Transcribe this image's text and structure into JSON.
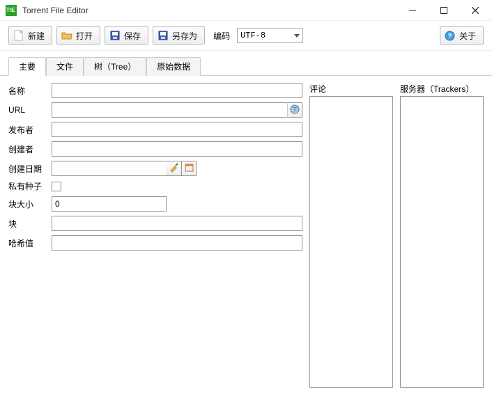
{
  "window": {
    "title": "Torrent File Editor"
  },
  "toolbar": {
    "new_label": "新建",
    "open_label": "打开",
    "save_label": "保存",
    "saveas_label": "另存为",
    "encoding_label": "编码",
    "encoding_value": "UTF-8",
    "about_label": "关于"
  },
  "tabs": {
    "main": "主要",
    "files": "文件",
    "tree": "树（Tree）",
    "raw": "原始数据"
  },
  "form": {
    "name_label": "名称",
    "name_value": "",
    "url_label": "URL",
    "url_value": "",
    "publisher_label": "发布者",
    "publisher_value": "",
    "creator_label": "创建者",
    "creator_value": "",
    "created_label": "创建日期",
    "created_value": "",
    "private_label": "私有种子",
    "piecesize_label": "块大小",
    "piecesize_value": "0",
    "pieces_label": "块",
    "pieces_value": "",
    "hash_label": "哈希值",
    "hash_value": ""
  },
  "side": {
    "comments_label": "评论",
    "trackers_label": "服务器（Trackers）"
  }
}
